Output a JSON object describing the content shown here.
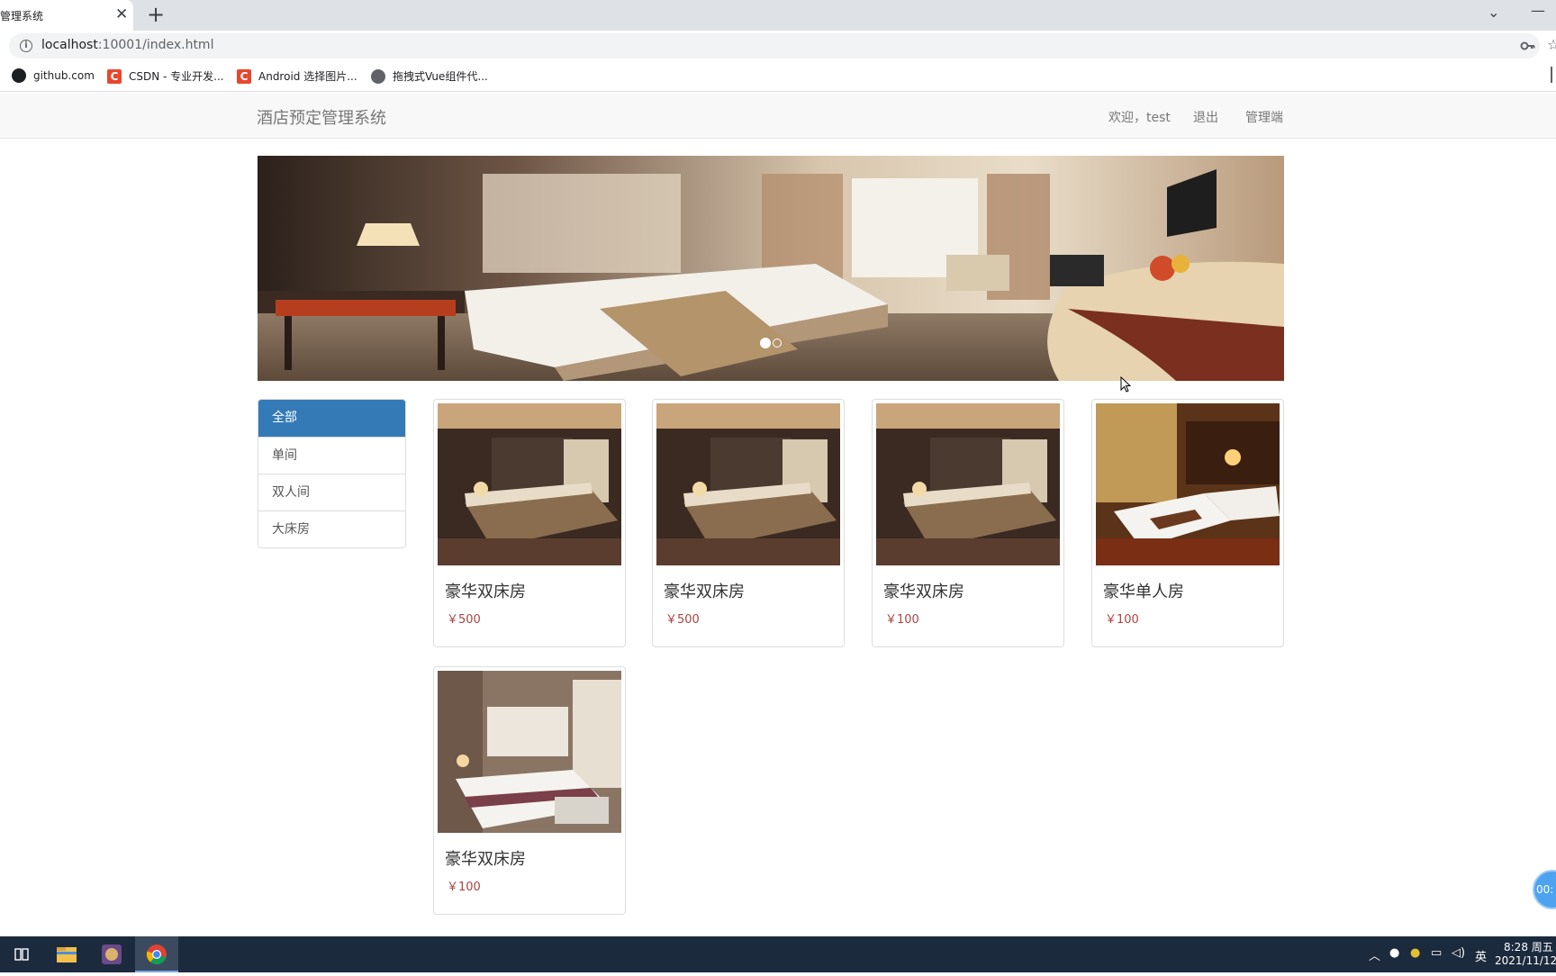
{
  "browser": {
    "tab_title": "管理系统",
    "tab_close": "✕",
    "new_tab": "+",
    "url_host": "localhost",
    "url_path": ":10001/index.html",
    "bookmarks": [
      {
        "label": "github.com",
        "icon": "github-icon"
      },
      {
        "label": "CSDN - 专业开发...",
        "icon": "csdn-icon",
        "glyph": "C"
      },
      {
        "label": "Android 选择图片...",
        "icon": "csdn-icon",
        "glyph": "C"
      },
      {
        "label": "拖拽式Vue组件代...",
        "icon": "globe-icon"
      }
    ]
  },
  "navbar": {
    "brand": "酒店预定管理系统",
    "welcome": "欢迎，test",
    "logout": "退出",
    "admin": "管理端"
  },
  "carousel": {
    "slide_count": 2,
    "active_index": 0
  },
  "categories": [
    {
      "label": "全部",
      "active": true
    },
    {
      "label": "单间",
      "active": false
    },
    {
      "label": "双人间",
      "active": false
    },
    {
      "label": "大床房",
      "active": false
    }
  ],
  "rooms": [
    {
      "title": "豪华双床房",
      "price": "￥500",
      "image": "luxury-twin-room"
    },
    {
      "title": "豪华双床房",
      "price": "￥500",
      "image": "luxury-twin-room"
    },
    {
      "title": "豪华双床房",
      "price": "￥100",
      "image": "luxury-twin-room"
    },
    {
      "title": "豪华单人房",
      "price": "￥100",
      "image": "luxury-single-room"
    },
    {
      "title": "豪华双床房",
      "price": "￥100",
      "image": "modern-bedroom"
    }
  ],
  "floating": {
    "timer": "00:"
  },
  "taskbar": {
    "time": "8:28 周五",
    "date": "2021/11/12",
    "ime": "英"
  },
  "colors": {
    "primary": "#337ab7",
    "price": "#a94442",
    "navbar_bg": "#f8f8f8",
    "taskbar_bg": "#1c2a3e"
  }
}
